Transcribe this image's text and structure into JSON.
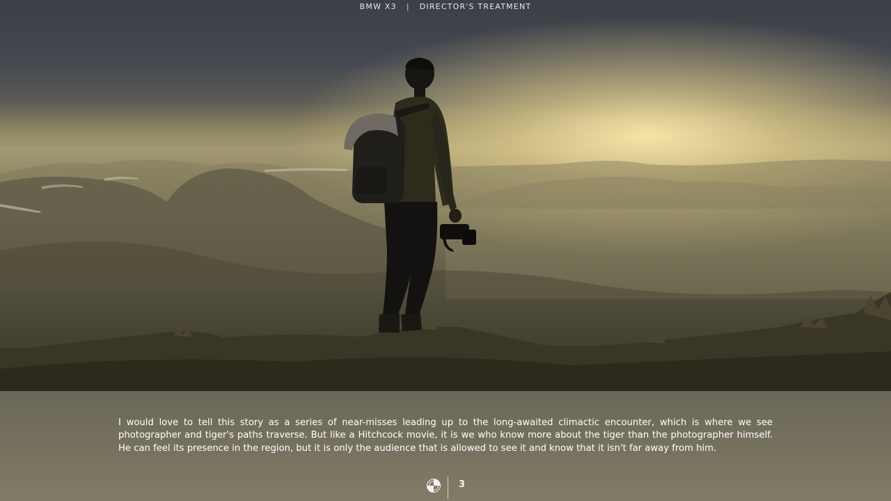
{
  "header": {
    "brand": "BMW X3",
    "separator": "|",
    "section": "DIRECTOR'S TREATMENT"
  },
  "body": {
    "paragraph": "I would love to tell this story as a series of near-misses leading up to the long-awaited climactic encounter, which is where we see photographer and tiger's paths traverse. But like a Hitchcock movie, it is we who know more about the tiger than the photographer himself. He can feel its presence in the region, but it is only the audience that is allowed to see it and know that it isn't far away from him."
  },
  "footer": {
    "logo_icon": "bmw-roundel-icon",
    "page_number": "3"
  },
  "colors": {
    "panel": "#77725f",
    "text": "#ffffff",
    "sky_dark": "#3b3f46",
    "sunlight": "#f5e3a6"
  }
}
